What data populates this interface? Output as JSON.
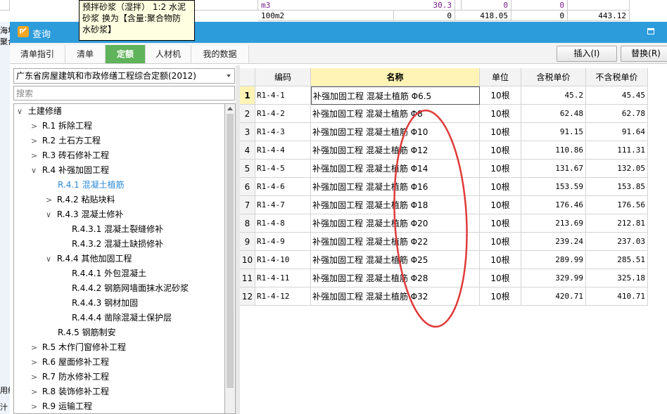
{
  "background": {
    "unit_row1": "m3",
    "value_row1": "30.3",
    "zero_a": "0",
    "zero_b": "0",
    "unit_row2": "100m2",
    "zero_c": "0",
    "value_row2a": "418.05",
    "zero_d": "0",
    "value_row2b": "443.12",
    "left_fragments": [
      "海块",
      "聚合",
      "用细",
      "汁"
    ]
  },
  "tooltip": {
    "lines": [
      "预拌砂浆（湿拌） 1:2 水泥",
      "砂浆  换为【含量:聚合物防",
      "水砂浆】"
    ]
  },
  "dialog": {
    "title": "查询",
    "tabs": [
      "清单指引",
      "清单",
      "定额",
      "人材机",
      "我的数据"
    ],
    "insert_label": "插入(I)",
    "replace_label": "替换(R)"
  },
  "left": {
    "library": "广东省房屋建筑和市政修缮工程综合定额(2012)",
    "search_placeholder": "搜索",
    "tree": [
      {
        "label": "土建修缮",
        "toggle": "∨"
      },
      {
        "label": "R.1 拆除工程",
        "toggle": ">"
      },
      {
        "label": "R.2 土石方工程",
        "toggle": ">"
      },
      {
        "label": "R.3 砖石修补工程",
        "toggle": ">"
      },
      {
        "label": "R.4 补强加固工程",
        "toggle": "∨"
      },
      {
        "label": "R.4.1 混凝土植筋",
        "toggle": ""
      },
      {
        "label": "R.4.2 粘贴块料",
        "toggle": ">"
      },
      {
        "label": "R.4.3 混凝土修补",
        "toggle": "∨"
      },
      {
        "label": "R.4.3.1 混凝土裂缝修补",
        "toggle": ""
      },
      {
        "label": "R.4.3.2 混凝土缺损修补",
        "toggle": ""
      },
      {
        "label": "R.4.4 其他加固工程",
        "toggle": "∨"
      },
      {
        "label": "R.4.4.1 外包混凝土",
        "toggle": ""
      },
      {
        "label": "R.4.4.2 钢筋网墙面抹水泥砂浆",
        "toggle": ""
      },
      {
        "label": "R.4.4.3 钢材加固",
        "toggle": ""
      },
      {
        "label": "R.4.4.4 凿除混凝土保护层",
        "toggle": ""
      },
      {
        "label": "R.4.5 钢筋制安",
        "toggle": ""
      },
      {
        "label": "R.5 木作门窗修补工程",
        "toggle": ">"
      },
      {
        "label": "R.6 屋面修补工程",
        "toggle": ">"
      },
      {
        "label": "R.7 防水修补工程",
        "toggle": ">"
      },
      {
        "label": "R.8 装饰修补工程",
        "toggle": ">"
      },
      {
        "label": "R.9 运输工程",
        "toggle": ">"
      }
    ]
  },
  "grid": {
    "headers": [
      "",
      "编码",
      "名称",
      "单位",
      "含税单价",
      "不含税单价"
    ],
    "rows": [
      [
        "1",
        "R1-4-1",
        "补强加固工程 混凝土植筋 Φ6.5",
        "10根",
        "45.2",
        "45.45"
      ],
      [
        "2",
        "R1-4-2",
        "补强加固工程 混凝土植筋 Φ8",
        "10根",
        "62.48",
        "62.78"
      ],
      [
        "3",
        "R1-4-3",
        "补强加固工程 混凝土植筋 Φ10",
        "10根",
        "91.15",
        "91.64"
      ],
      [
        "4",
        "R1-4-4",
        "补强加固工程 混凝土植筋 Φ12",
        "10根",
        "110.86",
        "111.31"
      ],
      [
        "5",
        "R1-4-5",
        "补强加固工程 混凝土植筋 Φ14",
        "10根",
        "131.67",
        "132.05"
      ],
      [
        "6",
        "R1-4-6",
        "补强加固工程 混凝土植筋 Φ16",
        "10根",
        "153.59",
        "153.85"
      ],
      [
        "7",
        "R1-4-7",
        "补强加固工程 混凝土植筋 Φ18",
        "10根",
        "176.46",
        "176.56"
      ],
      [
        "8",
        "R1-4-8",
        "补强加固工程 混凝土植筋 Φ20",
        "10根",
        "213.69",
        "212.81"
      ],
      [
        "9",
        "R1-4-9",
        "补强加固工程 混凝土植筋 Φ22",
        "10根",
        "239.24",
        "237.03"
      ],
      [
        "10",
        "R1-4-10",
        "补强加固工程 混凝土植筋 Φ25",
        "10根",
        "289.99",
        "285.51"
      ],
      [
        "11",
        "R1-4-11",
        "补强加固工程 混凝土植筋 Φ28",
        "10根",
        "329.99",
        "325.18"
      ],
      [
        "12",
        "R1-4-12",
        "补强加固工程 混凝土植筋 Φ32",
        "10根",
        "420.71",
        "410.71"
      ]
    ]
  },
  "colors": {
    "titlebar": "#2d9cdb",
    "active_tab": "#5fb35a",
    "selected_node": "#2d8ad8",
    "annotation": "#e03a3a"
  }
}
